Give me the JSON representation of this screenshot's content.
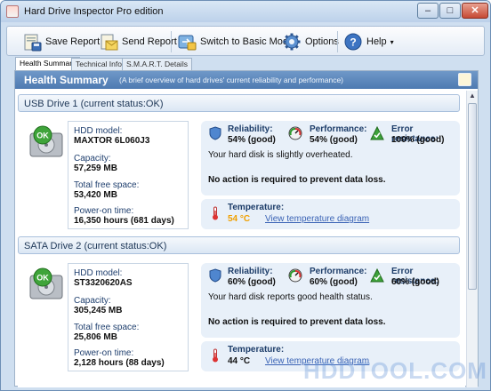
{
  "window": {
    "title": "Hard Drive Inspector Pro edition",
    "controls": {
      "minimize": "–",
      "maximize": "□",
      "close": "✕"
    }
  },
  "toolbar": {
    "buttons": [
      {
        "label": "Save Report",
        "icon": "save-report-icon"
      },
      {
        "label": "Send Report",
        "icon": "send-report-icon"
      },
      {
        "label": "Switch to Basic Mode",
        "icon": "switch-mode-icon"
      },
      {
        "label": "Options",
        "icon": "gear-icon"
      },
      {
        "label": "Help",
        "icon": "help-icon"
      }
    ],
    "help_caret": "▾"
  },
  "tabs": [
    {
      "label": "Health Summary",
      "active": true
    },
    {
      "label": "Technical Info",
      "active": false
    },
    {
      "label": "S.M.A.R.T. Details",
      "active": false
    }
  ],
  "summary": {
    "title": "Health Summary",
    "subtitle": "(A brief overview of hard drives' current reliability and performance)"
  },
  "scrollbar": {
    "up": "▲"
  },
  "status_badge": "OK",
  "drives": [
    {
      "title": "USB Drive 1 (current status:OK)",
      "model_label": "HDD model:",
      "model": "MAXTOR 6L060J3",
      "capacity_label": "Capacity:",
      "capacity": "57,259 MB",
      "free_label": "Total free space:",
      "free": "53,420 MB",
      "power_label": "Power-on time:",
      "power": "16,350 hours (681 days)",
      "reliability_label": "Reliability:",
      "reliability": "54% (good)",
      "performance_label": "Performance:",
      "performance": "54% (good)",
      "error_label": "Error resistance:",
      "error": "100% (good)",
      "message": "Your hard disk is slightly overheated.",
      "action": "No action is required to prevent data loss.",
      "temperature_label": "Temperature:",
      "temperature": "54 °C",
      "temperature_color": "#f0a000",
      "temperature_link": "View temperature diagram"
    },
    {
      "title": "SATA Drive 2 (current status:OK)",
      "model_label": "HDD model:",
      "model": "ST3320620AS",
      "capacity_label": "Capacity:",
      "capacity": "305,245 MB",
      "free_label": "Total free space:",
      "free": "25,806 MB",
      "power_label": "Power-on time:",
      "power": "2,128 hours (88 days)",
      "reliability_label": "Reliability:",
      "reliability": "60% (good)",
      "performance_label": "Performance:",
      "performance": "60% (good)",
      "error_label": "Error resistance:",
      "error": "60% (good)",
      "message": "Your hard disk reports good health status.",
      "action": "No action is required to prevent data loss.",
      "temperature_label": "Temperature:",
      "temperature": "44 °C",
      "temperature_color": "#111111",
      "temperature_link": "View temperature diagram"
    }
  ],
  "watermark": "HDDTOOL.COM"
}
